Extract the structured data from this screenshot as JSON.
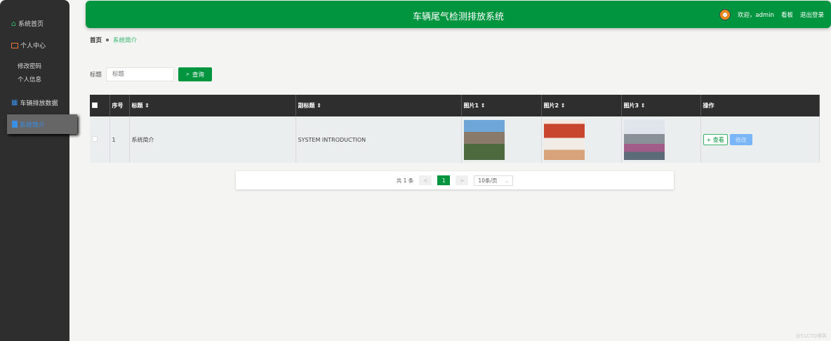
{
  "sidebar": {
    "items": [
      {
        "label": "系统首页"
      },
      {
        "label": "个人中心"
      },
      {
        "label": "修改密码"
      },
      {
        "label": "个人信息"
      },
      {
        "label": "车辆排放数据"
      },
      {
        "label": "系统简介"
      }
    ]
  },
  "header": {
    "title": "车辆尾气检测排放系统",
    "welcome": "欢迎，admin",
    "board": "看板",
    "logout": "退出登录"
  },
  "breadcrumb": {
    "home": "首页",
    "current": "系统简介"
  },
  "search": {
    "label": "标题",
    "placeholder": "标题",
    "button": "查询"
  },
  "table": {
    "headers": [
      "序号",
      "标题 ⇕",
      "副标题 ⇕",
      "图片1 ⇕",
      "图片2 ⇕",
      "图片3 ⇕",
      "操作"
    ],
    "rows": [
      {
        "index": "1",
        "title": "系统简介",
        "subtitle": "SYSTEM INTRODUCTION",
        "view": "+ 查看",
        "edit": "修改"
      }
    ]
  },
  "pagination": {
    "total": "共 1 条",
    "prev": "<",
    "page": "1",
    "next": ">",
    "size": "10条/页"
  },
  "watermark": "@51CTO博客",
  "colors": {
    "primary": "#02953f",
    "sidebar": "#2e2e2e"
  }
}
